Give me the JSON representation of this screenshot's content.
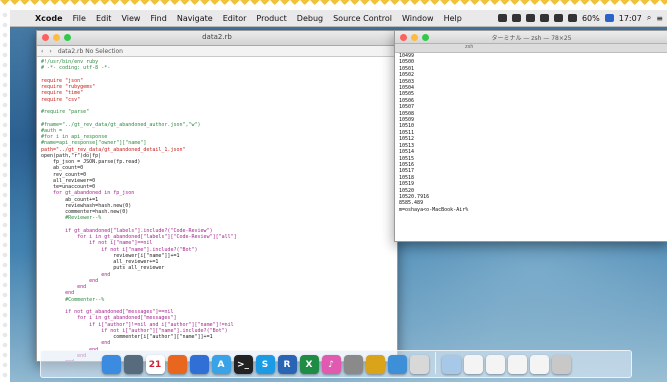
{
  "menubar": {
    "app_name": "Xcode",
    "items": [
      "File",
      "Edit",
      "View",
      "Find",
      "Navigate",
      "Editor",
      "Product",
      "Debug",
      "Source Control",
      "Window",
      "Help"
    ],
    "status": {
      "battery": "60%",
      "time": "17:07"
    }
  },
  "editor": {
    "title": "data2.rb",
    "jumpbar": "data2.rb  No Selection",
    "code_lines": [
      [
        "#!/usr/bin/env ruby",
        "cm"
      ],
      [
        "# -*- coding: utf-8 -*-",
        "cm"
      ],
      [
        "",
        "tx"
      ],
      [
        "require \"json\"",
        "st"
      ],
      [
        "require \"rubygems\"",
        "st"
      ],
      [
        "require \"time\"",
        "st"
      ],
      [
        "require \"csv\"",
        "st"
      ],
      [
        "",
        "tx"
      ],
      [
        "#require \"parse\"",
        "cm"
      ],
      [
        "",
        "tx"
      ],
      [
        "#fname=\"../gt_rev_data/gt_abandoned_author.json\",\"w\")",
        "cm"
      ],
      [
        "#auth =",
        "cm"
      ],
      [
        "#for i in api_response",
        "cm"
      ],
      [
        "#name=api_response[\"owner\"][\"name\"]",
        "cm"
      ],
      [
        "path=\"../gt_rev_data/gt_abandoned_detail_1.json\"",
        "st"
      ],
      [
        "open(path,\"r\")do|fp|",
        "tx"
      ],
      [
        "    fp_json = JSON.parse(fp.read)",
        "tx"
      ],
      [
        "    ab_count=0",
        "tx"
      ],
      [
        "    rev_count=0",
        "tx"
      ],
      [
        "    all_reviewer=0",
        "tx"
      ],
      [
        "    te=unaccount=0",
        "tx"
      ],
      [
        "    for gt_abandoned in fp_json",
        "kw"
      ],
      [
        "        ab_count+=1",
        "tx"
      ],
      [
        "        reviewhash=hash.new(0)",
        "tx"
      ],
      [
        "        commenter=hash.new(0)",
        "tx"
      ],
      [
        "        #Reviewer--%",
        "cm"
      ],
      [
        "",
        "tx"
      ],
      [
        "        if gt_abandoned[\"labels\"].include?(\"Code-Review\")",
        "kw"
      ],
      [
        "            for i in gt_abandoned[\"labels\"][\"Code-Review\"][\"all\"]",
        "kw"
      ],
      [
        "                if not i[\"name\"]==nil",
        "kw"
      ],
      [
        "                    if not i[\"name\"].include?(\"Bot\")",
        "kw"
      ],
      [
        "                        reviewer[i[\"name\"]]+=1",
        "tx"
      ],
      [
        "                        all_reviewer+=1",
        "tx"
      ],
      [
        "                        puts all_reviewer",
        "tx"
      ],
      [
        "                    end",
        "kw"
      ],
      [
        "                end",
        "kw"
      ],
      [
        "            end",
        "kw"
      ],
      [
        "        end",
        "kw"
      ],
      [
        "        #Commenter--%",
        "cm"
      ],
      [
        "",
        "tx"
      ],
      [
        "        if not gt_abandoned[\"messages\"]==nil",
        "kw"
      ],
      [
        "            for i in gt_abandoned[\"messages\"]",
        "kw"
      ],
      [
        "                if i[\"author\"]!=nil and i[\"author\"][\"name\"]!=nil",
        "kw"
      ],
      [
        "                    if not i[\"author\"][\"name\"].include?(\"Bot\")",
        "kw"
      ],
      [
        "                        commenter[i[\"author\"][\"name\"]]+=1",
        "tx"
      ],
      [
        "                    end",
        "kw"
      ],
      [
        "                end",
        "kw"
      ],
      [
        "            end",
        "kw"
      ],
      [
        "        end",
        "kw"
      ]
    ]
  },
  "terminal": {
    "title": "ターミナル — zsh — 78×25",
    "tab": "zsh",
    "lines": [
      "10499",
      "10500",
      "10501",
      "10502",
      "10503",
      "10504",
      "10505",
      "10506",
      "10507",
      "10508",
      "10509",
      "10510",
      "10511",
      "10512",
      "10513",
      "10514",
      "10515",
      "10516",
      "10517",
      "10518",
      "10519",
      "10520",
      "10520.7916",
      "8585.489",
      "m=oshaya<o-MacBook-Air% "
    ]
  },
  "dock": {
    "apps": [
      {
        "name": "finder",
        "color": "#3b8be0",
        "glyph": ""
      },
      {
        "name": "photos-app",
        "color": "#566b7d",
        "glyph": ""
      },
      {
        "name": "calendar",
        "color": "#ffffff",
        "glyph": "21"
      },
      {
        "name": "firefox",
        "color": "#e8661e",
        "glyph": ""
      },
      {
        "name": "app-2",
        "color": "#2f6fd6",
        "glyph": ""
      },
      {
        "name": "app-store",
        "color": "#3aa3e8",
        "glyph": "A"
      },
      {
        "name": "terminal-app",
        "color": "#222222",
        "glyph": ">_"
      },
      {
        "name": "skype",
        "color": "#1b9be6",
        "glyph": "S"
      },
      {
        "name": "app-r",
        "color": "#2964b5",
        "glyph": "R"
      },
      {
        "name": "excel",
        "color": "#1e8c45",
        "glyph": "X"
      },
      {
        "name": "itunes",
        "color": "#e05ab0",
        "glyph": "♪"
      },
      {
        "name": "tools-app",
        "color": "#8a8a8a",
        "glyph": ""
      },
      {
        "name": "chrome",
        "color": "#d9a419",
        "glyph": ""
      },
      {
        "name": "xcode-app",
        "color": "#3d8fd8",
        "glyph": ""
      },
      {
        "name": "script-editor",
        "color": "#d8d8d8",
        "glyph": ""
      }
    ],
    "docs": [
      {
        "name": "folder-stack",
        "color": "#a8c8e8",
        "glyph": ""
      },
      {
        "name": "document-1",
        "color": "#f4f4f4",
        "glyph": ""
      },
      {
        "name": "document-2",
        "color": "#f4f4f4",
        "glyph": ""
      },
      {
        "name": "document-3",
        "color": "#f4f4f4",
        "glyph": ""
      },
      {
        "name": "document-4",
        "color": "#f4f4f4",
        "glyph": ""
      },
      {
        "name": "trash",
        "color": "#c8c8c8",
        "glyph": ""
      }
    ]
  }
}
